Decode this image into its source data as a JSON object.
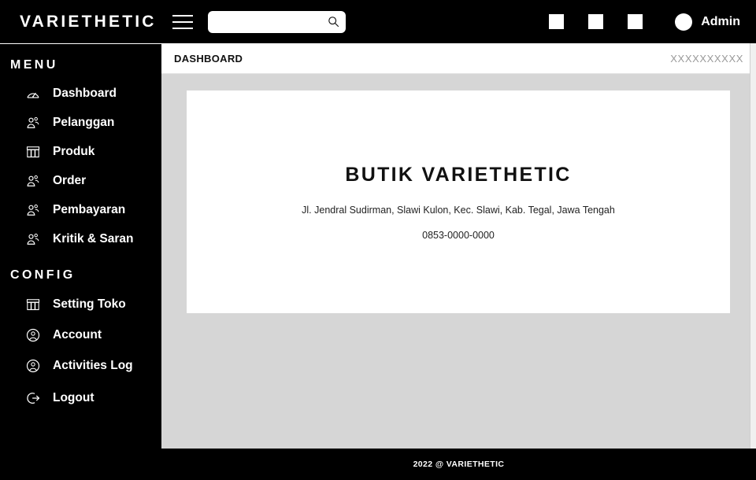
{
  "header": {
    "brand": "VARIETHETIC",
    "menu_toggle_name": "hamburger-menu",
    "search": {
      "value": "",
      "placeholder": ""
    },
    "icon_squares": [
      "square-icon-1",
      "square-icon-2",
      "square-icon-3"
    ],
    "user": {
      "name": "Admin",
      "avatar": "circle-avatar"
    }
  },
  "sidebar": {
    "sections": [
      {
        "title": "MENU",
        "items": [
          {
            "label": "Dashboard",
            "icon": "gauge-icon"
          },
          {
            "label": "Pelanggan",
            "icon": "users-icon"
          },
          {
            "label": "Produk",
            "icon": "store-icon"
          },
          {
            "label": "Order",
            "icon": "users-icon"
          },
          {
            "label": "Pembayaran",
            "icon": "users-icon"
          },
          {
            "label": "Kritik & Saran",
            "icon": "users-icon"
          }
        ]
      },
      {
        "title": "CONFIG",
        "items": [
          {
            "label": "Setting Toko",
            "icon": "store-icon"
          },
          {
            "label": "Account",
            "icon": "user-circle-icon"
          },
          {
            "label": "Activities Log",
            "icon": "user-circle-icon"
          },
          {
            "label": "Logout",
            "icon": "logout-icon"
          }
        ]
      }
    ]
  },
  "breadcrumb": {
    "title": "DASHBOARD",
    "right": "XXXXXXXXXX"
  },
  "card": {
    "store_name": "BUTIK VARIETHETIC",
    "address": "Jl. Jendral Sudirman, Slawi Kulon, Kec. Slawi, Kab. Tegal, Jawa Tengah",
    "phone": "0853-0000-0000"
  },
  "footer": {
    "text": "2022 @ VARIETHETIC"
  },
  "colors": {
    "black": "#000000",
    "white": "#ffffff",
    "content_bg": "#d6d6d6",
    "muted_text": "#9a9a9a"
  }
}
